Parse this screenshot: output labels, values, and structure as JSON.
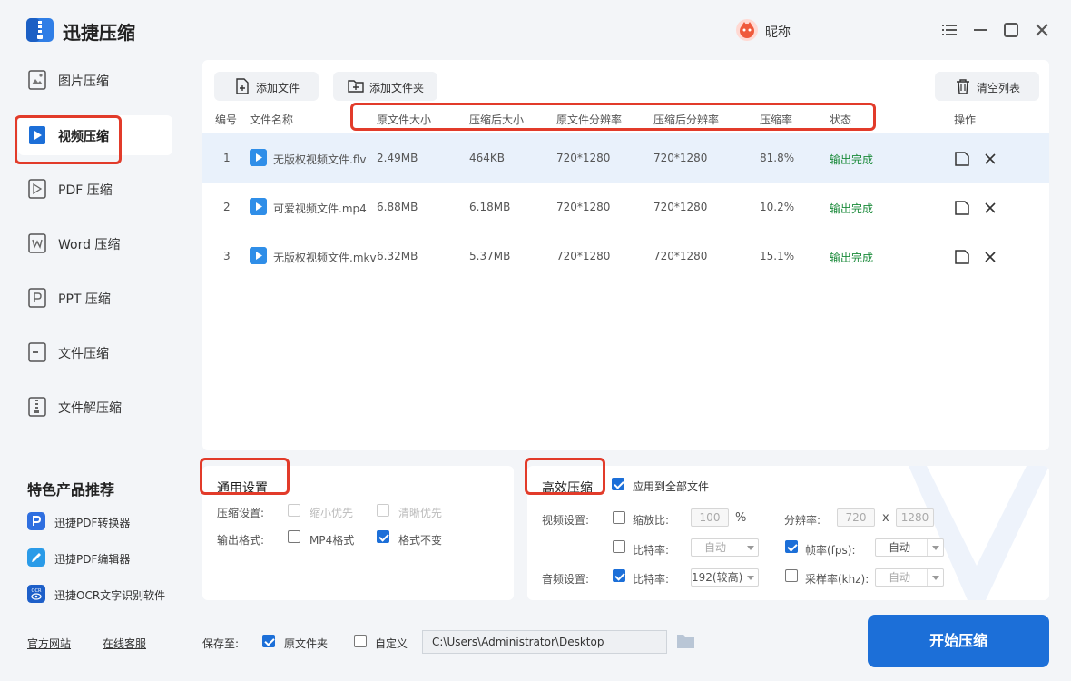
{
  "app": {
    "title": "迅捷压缩",
    "nickname": "昵称"
  },
  "sidebar": {
    "items": [
      {
        "label": "图片压缩",
        "icon": "image-file-icon"
      },
      {
        "label": "视频压缩",
        "icon": "video-file-icon"
      },
      {
        "label": "PDF 压缩",
        "icon": "pdf-file-icon"
      },
      {
        "label": "Word 压缩",
        "icon": "word-file-icon"
      },
      {
        "label": "PPT 压缩",
        "icon": "ppt-file-icon"
      },
      {
        "label": "文件压缩",
        "icon": "generic-file-icon"
      },
      {
        "label": "文件解压缩",
        "icon": "unzip-file-icon"
      }
    ],
    "active_index": 1,
    "featured_title": "特色产品推荐",
    "featured": [
      {
        "label": "迅捷PDF转换器",
        "color": "#2f6fe0"
      },
      {
        "label": "迅捷PDF编辑器",
        "color": "#2a9be8"
      },
      {
        "label": "迅捷OCR文字识别软件",
        "color": "#1d5fc9",
        "badge": "OCR"
      }
    ],
    "footer": {
      "website": "官方网站",
      "support": "在线客服"
    }
  },
  "toolbar": {
    "add_file": "添加文件",
    "add_folder": "添加文件夹",
    "clear_list": "清空列表"
  },
  "table": {
    "headers": {
      "num": "编号",
      "name": "文件名称",
      "orig_size": "原文件大小",
      "comp_size": "压缩后大小",
      "orig_res": "原文件分辨率",
      "comp_res": "压缩后分辨率",
      "ratio": "压缩率",
      "status": "状态",
      "action": "操作"
    },
    "rows": [
      {
        "num": "1",
        "name": "无版权视频文件.flv",
        "orig_size": "2.49MB",
        "comp_size": "464KB",
        "orig_res": "720*1280",
        "comp_res": "720*1280",
        "ratio": "81.8%",
        "status": "输出完成"
      },
      {
        "num": "2",
        "name": "可爱视频文件.mp4",
        "orig_size": "6.88MB",
        "comp_size": "6.18MB",
        "orig_res": "720*1280",
        "comp_res": "720*1280",
        "ratio": "10.2%",
        "status": "输出完成"
      },
      {
        "num": "3",
        "name": "无版权视频文件.mkv",
        "orig_size": "6.32MB",
        "comp_size": "5.37MB",
        "orig_res": "720*1280",
        "comp_res": "720*1280",
        "ratio": "15.1%",
        "status": "输出完成"
      }
    ],
    "selected_row": 0
  },
  "general": {
    "title": "通用设置",
    "compress_label": "压缩设置:",
    "opt_small": "缩小优先",
    "opt_clear": "清晰优先",
    "format_label": "输出格式:",
    "opt_mp4": "MP4格式",
    "opt_keep": "格式不变",
    "keep_checked": true
  },
  "efficient": {
    "title": "高效压缩",
    "apply_all": "应用到全部文件",
    "video_label": "视频设置:",
    "scale_label": "缩放比:",
    "scale_value": "100",
    "scale_unit": "%",
    "res_label": "分辨率:",
    "res_w": "720",
    "res_x": "x",
    "res_h": "1280",
    "bitrate_label": "比特率:",
    "bitrate_value": "自动",
    "fps_label": "帧率(fps):",
    "fps_value": "自动",
    "audio_label": "音频设置:",
    "audio_bitrate_label": "比特率:",
    "audio_bitrate_value": "192(较高)",
    "sample_label": "采样率(khz):",
    "sample_value": "自动"
  },
  "save": {
    "label": "保存至:",
    "orig_folder": "原文件夹",
    "custom": "自定义",
    "path": "C:\\Users\\Administrator\\Desktop"
  },
  "start_button": "开始压缩",
  "colors": {
    "accent": "#1c6fd8",
    "highlight_box": "#e23b2a",
    "status_done": "#1a8a3a"
  }
}
